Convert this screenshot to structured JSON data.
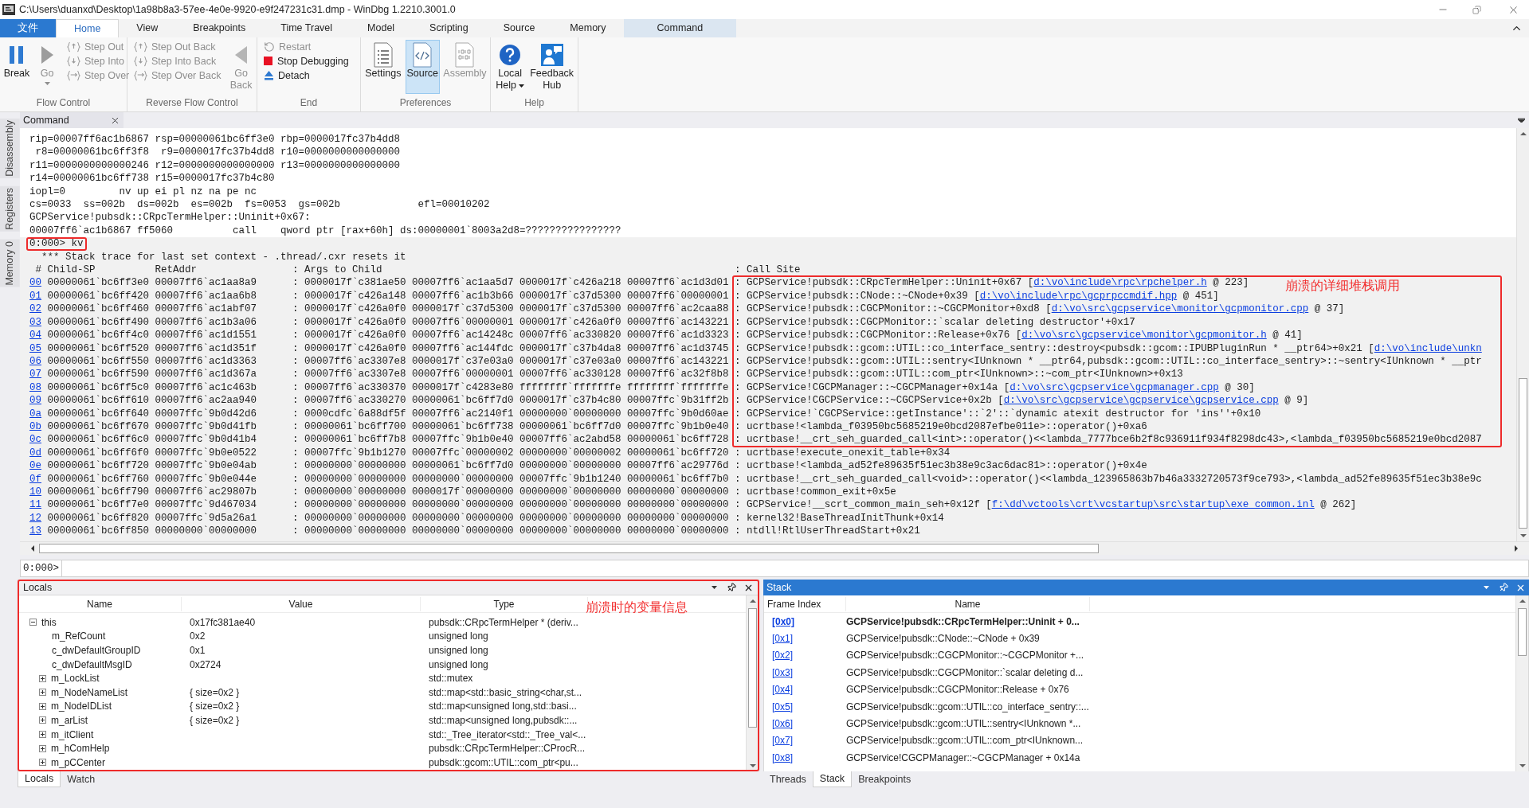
{
  "window": {
    "title": "C:\\Users\\duanxd\\Desktop\\1a98b8a3-57ee-4e0e-9920-e9f247231c31.dmp - WinDbg 1.2210.3001.0"
  },
  "ribbon_tabs": [
    {
      "label": "文件",
      "kind": "file",
      "selected": false
    },
    {
      "label": "Home",
      "kind": "tab",
      "selected": true
    },
    {
      "label": "View",
      "kind": "tab",
      "selected": false
    },
    {
      "label": "Breakpoints",
      "kind": "tab",
      "selected": false
    },
    {
      "label": "Time Travel",
      "kind": "tab",
      "selected": false
    },
    {
      "label": "Model",
      "kind": "tab",
      "selected": false
    },
    {
      "label": "Scripting",
      "kind": "tab",
      "selected": false
    },
    {
      "label": "Source",
      "kind": "tab",
      "selected": false
    },
    {
      "label": "Memory",
      "kind": "tab",
      "selected": false
    },
    {
      "label": "Command",
      "kind": "contextual",
      "selected": false
    }
  ],
  "ribbon_groups": [
    {
      "label": "Flow Control",
      "items": [
        {
          "lines": [
            "Break"
          ],
          "kind": "large",
          "disabled": false
        },
        {
          "lines": [
            "Go"
          ],
          "kind": "large",
          "disabled": true,
          "dropdown": true
        },
        {
          "label": "Step Out",
          "kind": "small",
          "disabled": true
        },
        {
          "label": "Step Into",
          "kind": "small",
          "disabled": true
        },
        {
          "label": "Step Over",
          "kind": "small",
          "disabled": true
        }
      ]
    },
    {
      "label": "Reverse Flow Control",
      "items": [
        {
          "label": "Step Out Back",
          "kind": "small",
          "disabled": true
        },
        {
          "label": "Step Into Back",
          "kind": "small",
          "disabled": true
        },
        {
          "label": "Step Over Back",
          "kind": "small",
          "disabled": true
        },
        {
          "lines": [
            "Go",
            "Back"
          ],
          "kind": "large",
          "disabled": true
        }
      ]
    },
    {
      "label": "End",
      "items": [
        {
          "label": "Restart",
          "kind": "small",
          "disabled": true
        },
        {
          "label": "Stop Debugging",
          "kind": "small",
          "disabled": false
        },
        {
          "label": "Detach",
          "kind": "small",
          "disabled": false
        }
      ]
    },
    {
      "label": "Preferences",
      "items": [
        {
          "lines": [
            "Settings"
          ],
          "kind": "large",
          "disabled": false,
          "selected": false
        },
        {
          "lines": [
            "Source"
          ],
          "kind": "large",
          "disabled": false,
          "selected": true
        },
        {
          "lines": [
            "Assembly"
          ],
          "kind": "large",
          "disabled": true,
          "selected": false
        }
      ]
    },
    {
      "label": "Help",
      "items": [
        {
          "lines": [
            "Local",
            "Help"
          ],
          "kind": "large",
          "disabled": false,
          "dropdown": true
        },
        {
          "lines": [
            "Feedback",
            "Hub"
          ],
          "kind": "large",
          "disabled": false
        }
      ]
    }
  ],
  "side_tabs": [
    "Disassembly",
    "Registers",
    "Memory 0"
  ],
  "command": {
    "tab": "Command",
    "output_lines": [
      "rip=00007ff6ac1b6867 rsp=00000061bc6ff3e0 rbp=0000017fc37b4dd8",
      " r8=00000061bc6ff3f8  r9=0000017fc37b4dd8 r10=0000000000000000",
      "r11=0000000000000246 r12=0000000000000000 r13=0000000000000000",
      "r14=00000061bc6ff738 r15=0000017fc37b4c80",
      "iopl=0         nv up ei pl nz na pe nc",
      "cs=0033  ss=002b  ds=002b  es=002b  fs=0053  gs=002b             efl=00010202",
      "GCPService!pubsdk::CRpcTermHelper::Uninit+0x67:",
      "00007ff6`ac1b6867 ff5060          call    qword ptr [rax+60h] ds:00000001`8003a2d8=????????????????"
    ],
    "prompt": "0:000> kv",
    "note": "  *** Stack trace for last set context - .thread/.cxr resets it",
    "columns": [
      " # Child-SP",
      "RetAddr",
      ": Args to Child",
      ": Call Site"
    ],
    "frames": [
      {
        "index": "00",
        "child_sp": "00000061`bc6ff3e0",
        "ret_addr": "00007ff6`ac1aa8a9",
        "args": ": 0000017f`c381ae50 00007ff6`ac1aa5d7 0000017f`c426a218 00007ff6`ac1d3d01",
        "call_site": ": GCPService!pubsdk::CRpcTermHelper::Uninit+0x67 [",
        "link": "d:\\vo\\include\\rpc\\rpchelper.h",
        "after": " @ 223]"
      },
      {
        "index": "01",
        "child_sp": "00000061`bc6ff420",
        "ret_addr": "00007ff6`ac1aa6b8",
        "args": ": 0000017f`c426a148 00007ff6`ac1b3b66 0000017f`c37d5300 00007ff6`00000001",
        "call_site": ": GCPService!pubsdk::CNode::~CNode+0x39 [",
        "link": "d:\\vo\\include\\rpc\\gcprpccmdif.hpp",
        "after": " @ 451]"
      },
      {
        "index": "02",
        "child_sp": "00000061`bc6ff460",
        "ret_addr": "00007ff6`ac1abf07",
        "args": ": 0000017f`c426a0f0 0000017f`c37d5300 0000017f`c37d5300 00007ff6`ac2caa88",
        "call_site": ": GCPService!pubsdk::CGCPMonitor::~CGCPMonitor+0xd8 [",
        "link": "d:\\vo\\src\\gcpservice\\monitor\\gcpmonitor.cpp",
        "after": " @ 37]"
      },
      {
        "index": "03",
        "child_sp": "00000061`bc6ff490",
        "ret_addr": "00007ff6`ac1b3a06",
        "args": ": 0000017f`c426a0f0 00007ff6`00000001 0000017f`c426a0f0 00007ff6`ac143221",
        "call_site": ": GCPService!pubsdk::CGCPMonitor::`scalar deleting destructor'+0x17"
      },
      {
        "index": "04",
        "child_sp": "00000061`bc6ff4c0",
        "ret_addr": "00007ff6`ac1d1551",
        "args": ": 0000017f`c426a0f0 00007ff6`ac14248c 00007ff6`ac330820 00007ff6`ac1d3323",
        "call_site": ": GCPService!pubsdk::CGCPMonitor::Release+0x76 [",
        "link": "d:\\vo\\src\\gcpservice\\monitor\\gcpmonitor.h",
        "after": " @ 41]"
      },
      {
        "index": "05",
        "child_sp": "00000061`bc6ff520",
        "ret_addr": "00007ff6`ac1d351f",
        "args": ": 0000017f`c426a0f0 00007ff6`ac144fdc 0000017f`c37b4da8 00007ff6`ac1d3745",
        "call_site": ": GCPService!pubsdk::gcom::UTIL::co_interface_sentry::destroy<pubsdk::gcom::IPUBPluginRun * __ptr64>+0x21 [",
        "link": "d:\\vo\\include\\unkn"
      },
      {
        "index": "06",
        "child_sp": "00000061`bc6ff550",
        "ret_addr": "00007ff6`ac1d3363",
        "args": ": 00007ff6`ac3307e8 0000017f`c37e03a0 0000017f`c37e03a0 00007ff6`ac143221",
        "call_site": ": GCPService!pubsdk::gcom::UTIL::sentry<IUnknown * __ptr64,pubsdk::gcom::UTIL::co_interface_sentry>::~sentry<IUnknown * __ptr"
      },
      {
        "index": "07",
        "child_sp": "00000061`bc6ff590",
        "ret_addr": "00007ff6`ac1d367a",
        "args": ": 00007ff6`ac3307e8 00007ff6`00000001 00007ff6`ac330128 00007ff6`ac32f8b8",
        "call_site": ": GCPService!pubsdk::gcom::UTIL::com_ptr<IUnknown>::~com_ptr<IUnknown>+0x13"
      },
      {
        "index": "08",
        "child_sp": "00000061`bc6ff5c0",
        "ret_addr": "00007ff6`ac1c463b",
        "args": ": 00007ff6`ac330370 0000017f`c4283e80 ffffffff`fffffffe ffffffff`fffffffe",
        "call_site": ": GCPService!CGCPManager::~CGCPManager+0x14a [",
        "link": "d:\\vo\\src\\gcpservice\\gcpmanager.cpp",
        "after": " @ 30]"
      },
      {
        "index": "09",
        "child_sp": "00000061`bc6ff610",
        "ret_addr": "00007ff6`ac2aa940",
        "args": ": 00007ff6`ac330270 00000061`bc6ff7d0 0000017f`c37b4c80 00007ffc`9b31ff2b",
        "call_site": ": GCPService!CGCPService::~CGCPService+0x2b [",
        "link": "d:\\vo\\src\\gcpservice\\gcpservice\\gcpservice.cpp",
        "after": " @ 9]"
      },
      {
        "index": "0a",
        "child_sp": "00000061`bc6ff640",
        "ret_addr": "00007ffc`9b0d42d6",
        "args": ": 0000cdfc`6a88df5f 00007ff6`ac2140f1 00000000`00000000 00007ffc`9b0d60ae",
        "call_site": ": GCPService!`CGCPService::getInstance'::`2'::`dynamic atexit destructor for 'ins''+0x10"
      },
      {
        "index": "0b",
        "child_sp": "00000061`bc6ff670",
        "ret_addr": "00007ffc`9b0d41fb",
        "args": ": 00000061`bc6ff700 00000061`bc6ff738 00000061`bc6ff7d0 00007ffc`9b1b0e40",
        "call_site": ": ucrtbase!<lambda_f03950bc5685219e0bcd2087efbe011e>::operator()+0xa6"
      },
      {
        "index": "0c",
        "child_sp": "00000061`bc6ff6c0",
        "ret_addr": "00007ffc`9b0d41b4",
        "args": ": 00000061`bc6ff7b8 00007ffc`9b1b0e40 00007ff6`ac2abd58 00000061`bc6ff728",
        "call_site": ": ucrtbase!__crt_seh_guarded_call<int>::operator()<<lambda_7777bce6b2f8c936911f934f8298dc43>,<lambda_f03950bc5685219e0bcd2087"
      },
      {
        "index": "0d",
        "child_sp": "00000061`bc6ff6f0",
        "ret_addr": "00007ffc`9b0e0522",
        "args": ": 00007ffc`9b1b1270 00007ffc`00000002 00000000`00000002 00000061`bc6ff720",
        "call_site": ": ucrtbase!execute_onexit_table+0x34"
      },
      {
        "index": "0e",
        "child_sp": "00000061`bc6ff720",
        "ret_addr": "00007ffc`9b0e04ab",
        "args": ": 00000000`00000000 00000061`bc6ff7d0 00000000`00000000 00007ff6`ac29776d",
        "call_site": ": ucrtbase!<lambda_ad52fe89635f51ec3b38e9c3ac6dac81>::operator()+0x4e"
      },
      {
        "index": "0f",
        "child_sp": "00000061`bc6ff760",
        "ret_addr": "00007ffc`9b0e044e",
        "args": ": 00000000`00000000 00000000`00000000 00007ffc`9b1b1240 00000061`bc6ff7b0",
        "call_site": ": ucrtbase!__crt_seh_guarded_call<void>::operator()<<lambda_123965863b7b46a3332720573f9ce793>,<lambda_ad52fe89635f51ec3b38e9c"
      },
      {
        "index": "10",
        "child_sp": "00000061`bc6ff790",
        "ret_addr": "00007ff6`ac29807b",
        "args": ": 00000000`00000000 0000017f`00000000 00000000`00000000 00000000`00000000",
        "call_site": ": ucrtbase!common_exit+0x5e"
      },
      {
        "index": "11",
        "child_sp": "00000061`bc6ff7e0",
        "ret_addr": "00007ffc`9d467034",
        "args": ": 00000000`00000000 00000000`00000000 00000000`00000000 00000000`00000000",
        "call_site": ": GCPService!__scrt_common_main_seh+0x12f [",
        "link": "f:\\dd\\vctools\\crt\\vcstartup\\src\\startup\\exe_common.inl",
        "after": " @ 262]"
      },
      {
        "index": "12",
        "child_sp": "00000061`bc6ff820",
        "ret_addr": "00007ffc`9d5a26a1",
        "args": ": 00000000`00000000 00000000`00000000 00000000`00000000 00000000`00000000",
        "call_site": ": kernel32!BaseThreadInitThunk+0x14"
      },
      {
        "index": "13",
        "child_sp": "00000061`bc6ff850",
        "ret_addr": "00000000`00000000",
        "args": ": 00000000`00000000 00000000`00000000 00000000`00000000 00000000`00000000",
        "call_site": ": ntdll!RtlUserThreadStart+0x21"
      }
    ],
    "annotation": "崩溃的详细堆栈调用",
    "input_prompt": "0:000>"
  },
  "locals": {
    "title": "Locals",
    "annotation": "崩溃时的变量信息",
    "columns": [
      "Name",
      "Value",
      "Type"
    ],
    "rows": [
      {
        "name": "this",
        "value": "0x17fc381ae40",
        "type": "pubsdk::CRpcTermHelper * (deriv...",
        "expanded": true,
        "children": [
          {
            "name": "m_RefCount",
            "value": "0x2",
            "type": "unsigned long",
            "kind": "leaf"
          },
          {
            "name": "c_dwDefaultGroupID",
            "value": "0x1",
            "type": "unsigned long",
            "kind": "leaf"
          },
          {
            "name": "c_dwDefaultMsgID",
            "value": "0x2724",
            "type": "unsigned long",
            "kind": "leaf"
          },
          {
            "name": "m_LockList",
            "type": "std::mutex",
            "kind": "group",
            "expanded": false
          },
          {
            "name": "m_NodeNameList",
            "value": "{ size=0x2 }",
            "type": "std::map<std::basic_string<char,st...",
            "kind": "group",
            "expanded": false
          },
          {
            "name": "m_NodeIDList",
            "value": "{ size=0x2 }",
            "type": "std::map<unsigned long,std::basi...",
            "kind": "group",
            "expanded": false
          },
          {
            "name": "m_arList",
            "value": "{ size=0x2 }",
            "type": "std::map<unsigned long,pubsdk::...",
            "kind": "group",
            "expanded": false
          },
          {
            "name": "m_itClient",
            "type": "std::_Tree_iterator<std::_Tree_val<...",
            "kind": "group",
            "expanded": false
          },
          {
            "name": "m_hComHelp",
            "type": "pubsdk::CRpcTermHelper::CProcR...",
            "kind": "group",
            "expanded": false
          },
          {
            "name": "m_pCCenter",
            "type": "pubsdk::gcom::UTIL::com_ptr<pu...",
            "kind": "group",
            "expanded": false
          }
        ]
      }
    ],
    "tabs": [
      {
        "label": "Locals",
        "selected": true
      },
      {
        "label": "Watch",
        "selected": false
      }
    ]
  },
  "stack": {
    "title": "Stack",
    "columns": [
      "Frame Index",
      "Name"
    ],
    "rows": [
      {
        "index": "[0x0]",
        "name": "GCPService!pubsdk::CRpcTermHelper::Uninit + 0...",
        "selected": true
      },
      {
        "index": "[0x1]",
        "name": "GCPService!pubsdk::CNode::~CNode + 0x39",
        "selected": false
      },
      {
        "index": "[0x2]",
        "name": "GCPService!pubsdk::CGCPMonitor::~CGCPMonitor +...",
        "selected": false
      },
      {
        "index": "[0x3]",
        "name": "GCPService!pubsdk::CGCPMonitor::`scalar deleting d...",
        "selected": false
      },
      {
        "index": "[0x4]",
        "name": "GCPService!pubsdk::CGCPMonitor::Release + 0x76",
        "selected": false
      },
      {
        "index": "[0x5]",
        "name": "GCPService!pubsdk::gcom::UTIL::co_interface_sentry::...",
        "selected": false
      },
      {
        "index": "[0x6]",
        "name": "GCPService!pubsdk::gcom::UTIL::sentry<IUnknown *...",
        "selected": false
      },
      {
        "index": "[0x7]",
        "name": "GCPService!pubsdk::gcom::UTIL::com_ptr<IUnknown...",
        "selected": false
      },
      {
        "index": "[0x8]",
        "name": "GCPService!CGCPManager::~CGCPManager + 0x14a",
        "selected": false
      }
    ],
    "tabs": [
      {
        "label": "Threads",
        "selected": false
      },
      {
        "label": "Stack",
        "selected": true
      },
      {
        "label": "Breakpoints",
        "selected": false
      }
    ]
  }
}
